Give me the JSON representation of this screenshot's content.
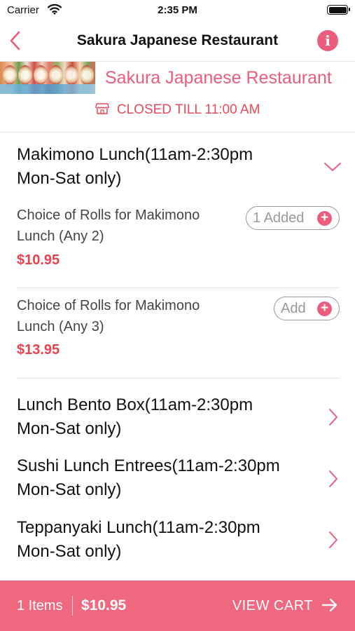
{
  "status_bar": {
    "carrier": "Carrier",
    "time": "2:35 PM",
    "wifi_icon": "wifi-icon",
    "battery_icon": "battery-icon"
  },
  "nav": {
    "title": "Sakura Japanese Restaurant",
    "back_icon": "chevron-left-icon",
    "info_icon": "info-icon",
    "info_glyph": "i"
  },
  "restaurant": {
    "name": "Sakura Japanese Restaurant",
    "status": "CLOSED TILL 11:00 AM",
    "status_icon": "store-icon"
  },
  "menu": {
    "expanded_category": {
      "title_line1": "Makimono Lunch(11am-2:30pm",
      "title_line2": "Mon-Sat only)",
      "icon": "chevron-down-icon",
      "items": [
        {
          "name_line1": "Choice of Rolls for Makimono",
          "name_line2": "Lunch (Any 2)",
          "price": "$10.95",
          "button_label": "1 Added",
          "button_icon": "plus-icon"
        },
        {
          "name_line1": "Choice of Rolls for Makimono",
          "name_line2": "Lunch (Any 3)",
          "price": "$13.95",
          "button_label": "Add",
          "button_icon": "plus-icon"
        }
      ]
    },
    "categories": [
      {
        "title_line1": "Lunch Bento Box(11am-2:30pm",
        "title_line2": "Mon-Sat only)",
        "icon": "chevron-right-icon"
      },
      {
        "title_line1": "Sushi Lunch Entrees(11am-2:30pm",
        "title_line2": "Mon-Sat only)",
        "icon": "chevron-right-icon"
      },
      {
        "title_line1": "Teppanyaki Lunch(11am-2:30pm",
        "title_line2": "Mon-Sat only)",
        "icon": "chevron-right-icon"
      }
    ]
  },
  "cart": {
    "count": "1 Items",
    "total": "$10.95",
    "action": "VIEW CART",
    "icon": "arrow-right-icon"
  },
  "colors": {
    "accent": "#ea5d7c",
    "price": "#e8424f",
    "cart_bar": "#f06780"
  }
}
